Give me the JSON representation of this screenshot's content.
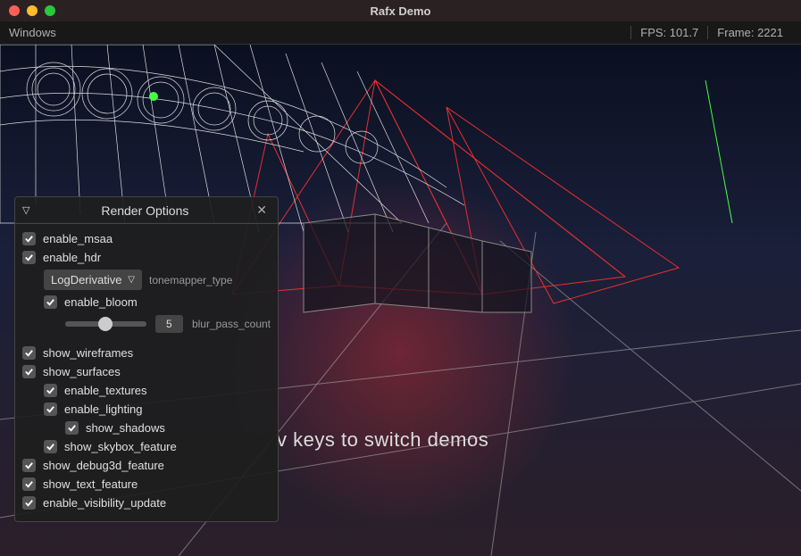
{
  "window": {
    "title": "Rafx Demo"
  },
  "menubar": {
    "menu_windows": "Windows",
    "fps_label": "FPS: 101.7",
    "frame_label": "Frame: 2221"
  },
  "viewport": {
    "hint_text": "v keys to switch demos"
  },
  "panel": {
    "title": "Render Options",
    "options": {
      "enable_msaa": "enable_msaa",
      "enable_hdr": "enable_hdr",
      "tonemapper_value": "LogDerivative",
      "tonemapper_label": "tonemapper_type",
      "enable_bloom": "enable_bloom",
      "blur_pass_value": "5",
      "blur_pass_label": "blur_pass_count",
      "show_wireframes": "show_wireframes",
      "show_surfaces": "show_surfaces",
      "enable_textures": "enable_textures",
      "enable_lighting": "enable_lighting",
      "show_shadows": "show_shadows",
      "show_skybox_feature": "show_skybox_feature",
      "show_debug3d_feature": "show_debug3d_feature",
      "show_text_feature": "show_text_feature",
      "enable_visibility_update": "enable_visibility_update"
    }
  }
}
